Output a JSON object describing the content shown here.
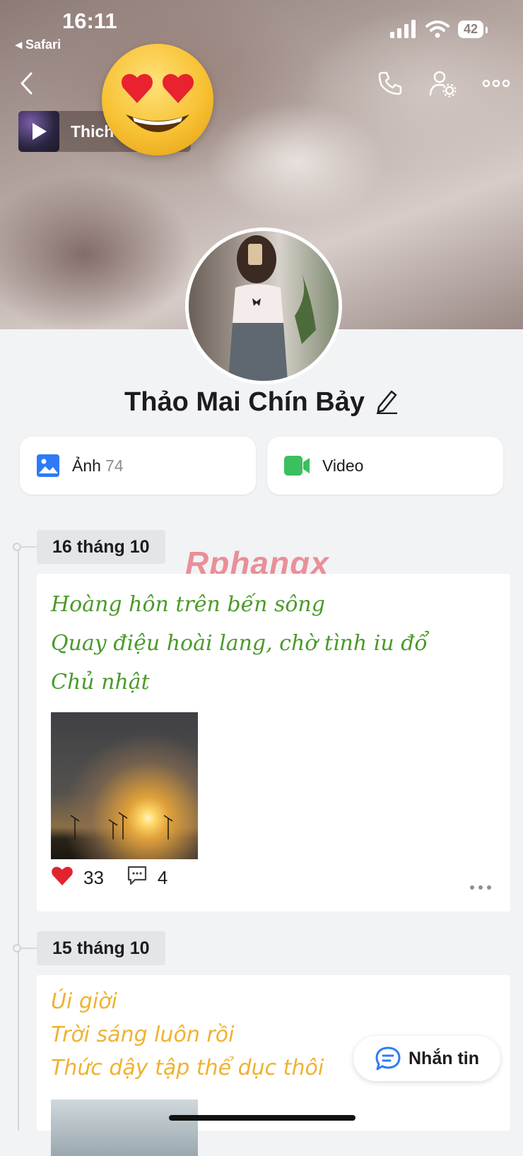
{
  "status_bar": {
    "time": "16:11",
    "back_app": "◂ Safari",
    "battery": "42"
  },
  "music": {
    "title": "ThichThich"
  },
  "profile": {
    "name": "Thảo Mai Chín Bảy"
  },
  "media": {
    "photos": {
      "label": "Ảnh",
      "count": "74"
    },
    "video": {
      "label": "Video"
    }
  },
  "watermark": "Rphangx",
  "posts": [
    {
      "date": "16 tháng 10",
      "lines": [
        "Hoàng hôn trên bến sông",
        "Quay điệu hoài lang, chờ tình iu đổ",
        "Chủ nhật"
      ],
      "likes": "33",
      "comments": "4"
    },
    {
      "date": "15 tháng 10",
      "lines": [
        "Úi giời",
        "Trời sáng luôn rồi",
        "Thức dậy tập thể dục thôi"
      ]
    }
  ],
  "chat_button": {
    "label": "Nhắn tin"
  },
  "colors": {
    "green_text": "#4b9a2a",
    "orange_text": "#f0b230",
    "heart": "#e0242e",
    "accent_blue": "#2f7bf5",
    "video_green": "#3cbf5e"
  }
}
